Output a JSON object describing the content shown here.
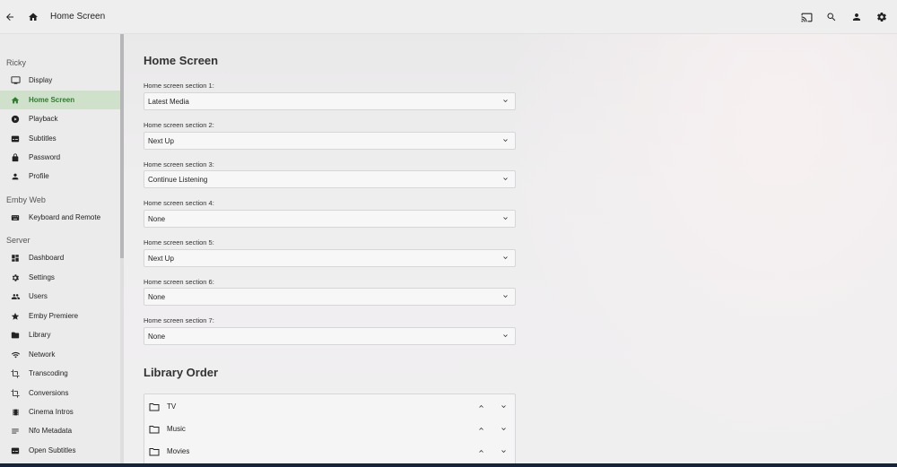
{
  "header": {
    "title": "Home Screen",
    "icons": [
      "back-arrow-icon",
      "home-icon",
      "cast-icon",
      "search-icon",
      "user-icon",
      "gear-icon"
    ]
  },
  "sidebar": {
    "user_section": "Ricky",
    "user_items": [
      {
        "label": "Display",
        "icon": "monitor-icon"
      },
      {
        "label": "Home Screen",
        "icon": "home-icon",
        "active": true
      },
      {
        "label": "Playback",
        "icon": "play-circle-icon"
      },
      {
        "label": "Subtitles",
        "icon": "subtitles-icon"
      },
      {
        "label": "Password",
        "icon": "lock-icon"
      },
      {
        "label": "Profile",
        "icon": "person-icon"
      }
    ],
    "web_section": "Emby Web",
    "web_items": [
      {
        "label": "Keyboard and Remote",
        "icon": "keyboard-icon"
      }
    ],
    "server_section": "Server",
    "server_items": [
      {
        "label": "Dashboard",
        "icon": "dashboard-icon"
      },
      {
        "label": "Settings",
        "icon": "gear-icon"
      },
      {
        "label": "Users",
        "icon": "people-icon"
      },
      {
        "label": "Emby Premiere",
        "icon": "star-icon"
      },
      {
        "label": "Library",
        "icon": "folder-icon"
      },
      {
        "label": "Network",
        "icon": "wifi-icon"
      },
      {
        "label": "Transcoding",
        "icon": "crop-icon"
      },
      {
        "label": "Conversions",
        "icon": "crop-icon"
      },
      {
        "label": "Cinema Intros",
        "icon": "film-icon"
      },
      {
        "label": "Nfo Metadata",
        "icon": "lines-icon"
      },
      {
        "label": "Open Subtitles",
        "icon": "subtitles-icon"
      }
    ]
  },
  "main": {
    "title": "Home Screen",
    "sections": [
      {
        "label": "Home screen section 1:",
        "value": "Latest Media"
      },
      {
        "label": "Home screen section 2:",
        "value": "Next Up"
      },
      {
        "label": "Home screen section 3:",
        "value": "Continue Listening"
      },
      {
        "label": "Home screen section 4:",
        "value": "None"
      },
      {
        "label": "Home screen section 5:",
        "value": "Next Up"
      },
      {
        "label": "Home screen section 6:",
        "value": "None"
      },
      {
        "label": "Home screen section 7:",
        "value": "None"
      }
    ],
    "library_order_title": "Library Order",
    "libraries": [
      {
        "name": "TV"
      },
      {
        "name": "Music"
      },
      {
        "name": "Movies"
      }
    ]
  },
  "colors": {
    "accent": "#2c7d2c",
    "active_bg": "#cfe1cb",
    "bottom_bar": "#15233b"
  }
}
